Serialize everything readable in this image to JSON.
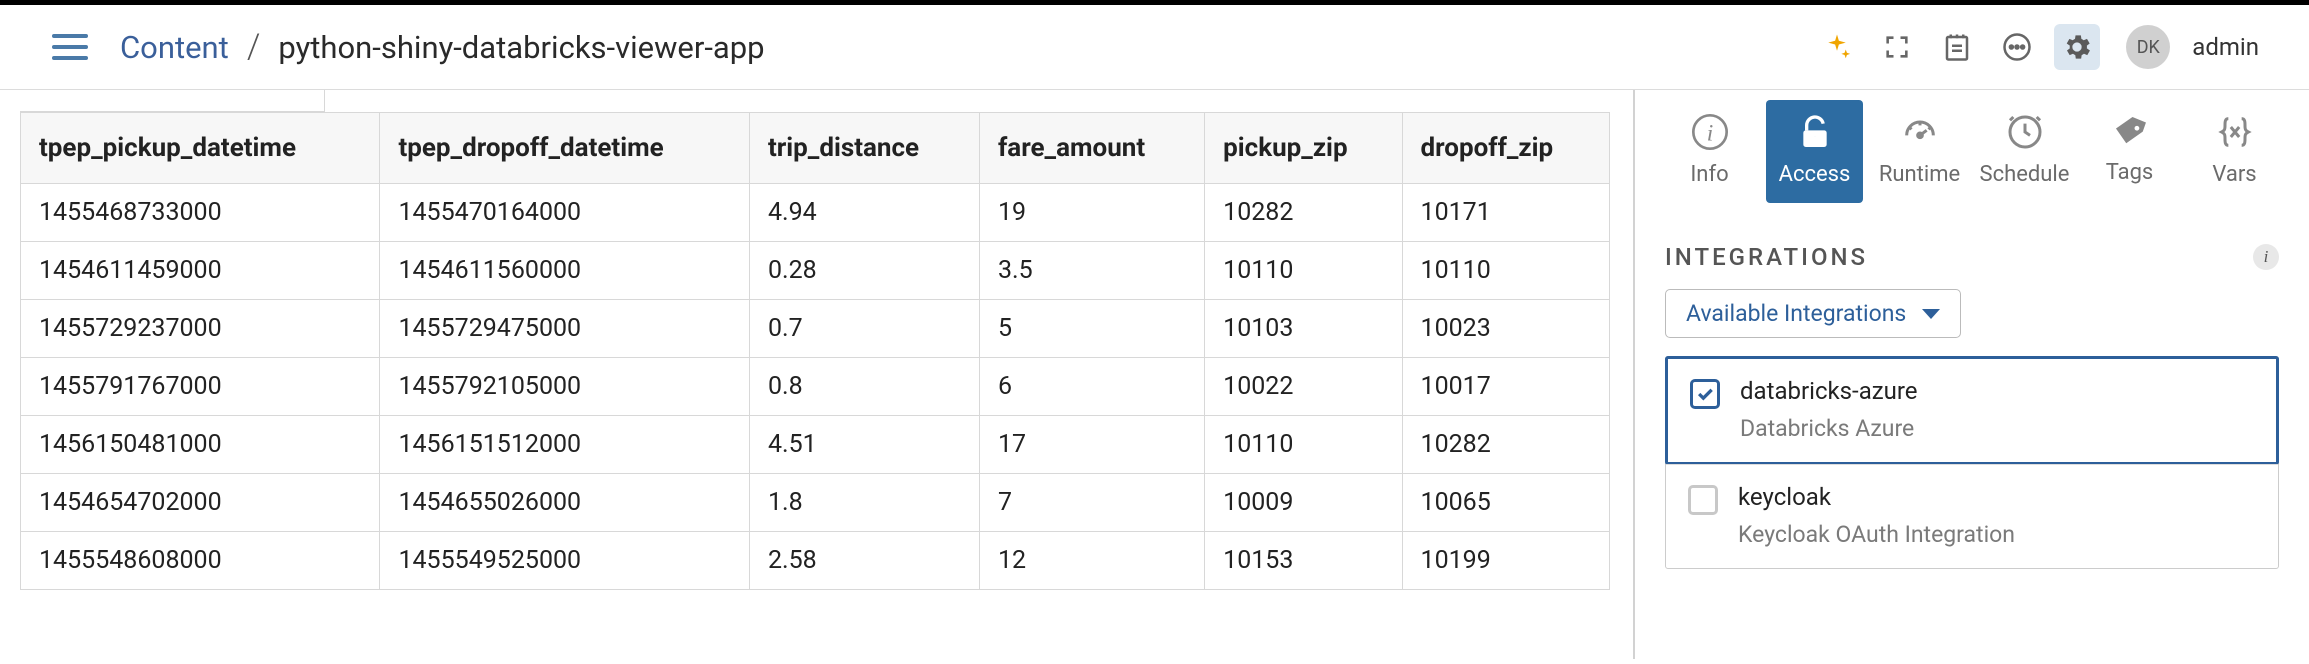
{
  "breadcrumb": {
    "root": "Content",
    "leaf": "python-shiny-databricks-viewer-app"
  },
  "user": {
    "initials": "DK",
    "name": "admin"
  },
  "table": {
    "columns": [
      "tpep_pickup_datetime",
      "tpep_dropoff_datetime",
      "trip_distance",
      "fare_amount",
      "pickup_zip",
      "dropoff_zip"
    ],
    "rows": [
      [
        "1455468733000",
        "1455470164000",
        "4.94",
        "19",
        "10282",
        "10171"
      ],
      [
        "1454611459000",
        "1454611560000",
        "0.28",
        "3.5",
        "10110",
        "10110"
      ],
      [
        "1455729237000",
        "1455729475000",
        "0.7",
        "5",
        "10103",
        "10023"
      ],
      [
        "1455791767000",
        "1455792105000",
        "0.8",
        "6",
        "10022",
        "10017"
      ],
      [
        "1456150481000",
        "1456151512000",
        "4.51",
        "17",
        "10110",
        "10282"
      ],
      [
        "1454654702000",
        "1454655026000",
        "1.8",
        "7",
        "10009",
        "10065"
      ],
      [
        "1455548608000",
        "1455549525000",
        "2.58",
        "12",
        "10153",
        "10199"
      ]
    ]
  },
  "panel": {
    "tabs": {
      "info": "Info",
      "access": "Access",
      "runtime": "Runtime",
      "schedule": "Schedule",
      "tags": "Tags",
      "vars": "Vars"
    },
    "section_title": "INTEGRATIONS",
    "dropdown_label": "Available Integrations",
    "integrations": [
      {
        "name": "databricks-azure",
        "desc": "Databricks Azure",
        "checked": true
      },
      {
        "name": "keycloak",
        "desc": "Keycloak OAuth Integration",
        "checked": false
      }
    ]
  }
}
